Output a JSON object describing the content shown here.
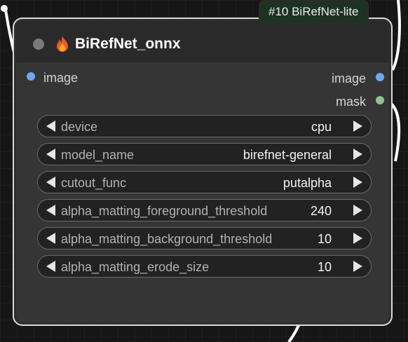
{
  "badge": "#10 BiRefNet-lite",
  "node": {
    "title": "BiRefNet_onnx",
    "inputs": [
      {
        "label": "image",
        "color": "#6ea8f0"
      }
    ],
    "outputs": [
      {
        "label": "image",
        "color": "#6ea8f0"
      },
      {
        "label": "mask",
        "color": "#8ec38e"
      }
    ],
    "widgets": [
      {
        "label": "device",
        "value": "cpu"
      },
      {
        "label": "model_name",
        "value": "birefnet-general"
      },
      {
        "label": "cutout_func",
        "value": "putalpha"
      },
      {
        "label": "alpha_matting_foreground_threshold",
        "value": "240"
      },
      {
        "label": "alpha_matting_background_threshold",
        "value": "10"
      },
      {
        "label": "alpha_matting_erode_size",
        "value": "10"
      }
    ]
  }
}
